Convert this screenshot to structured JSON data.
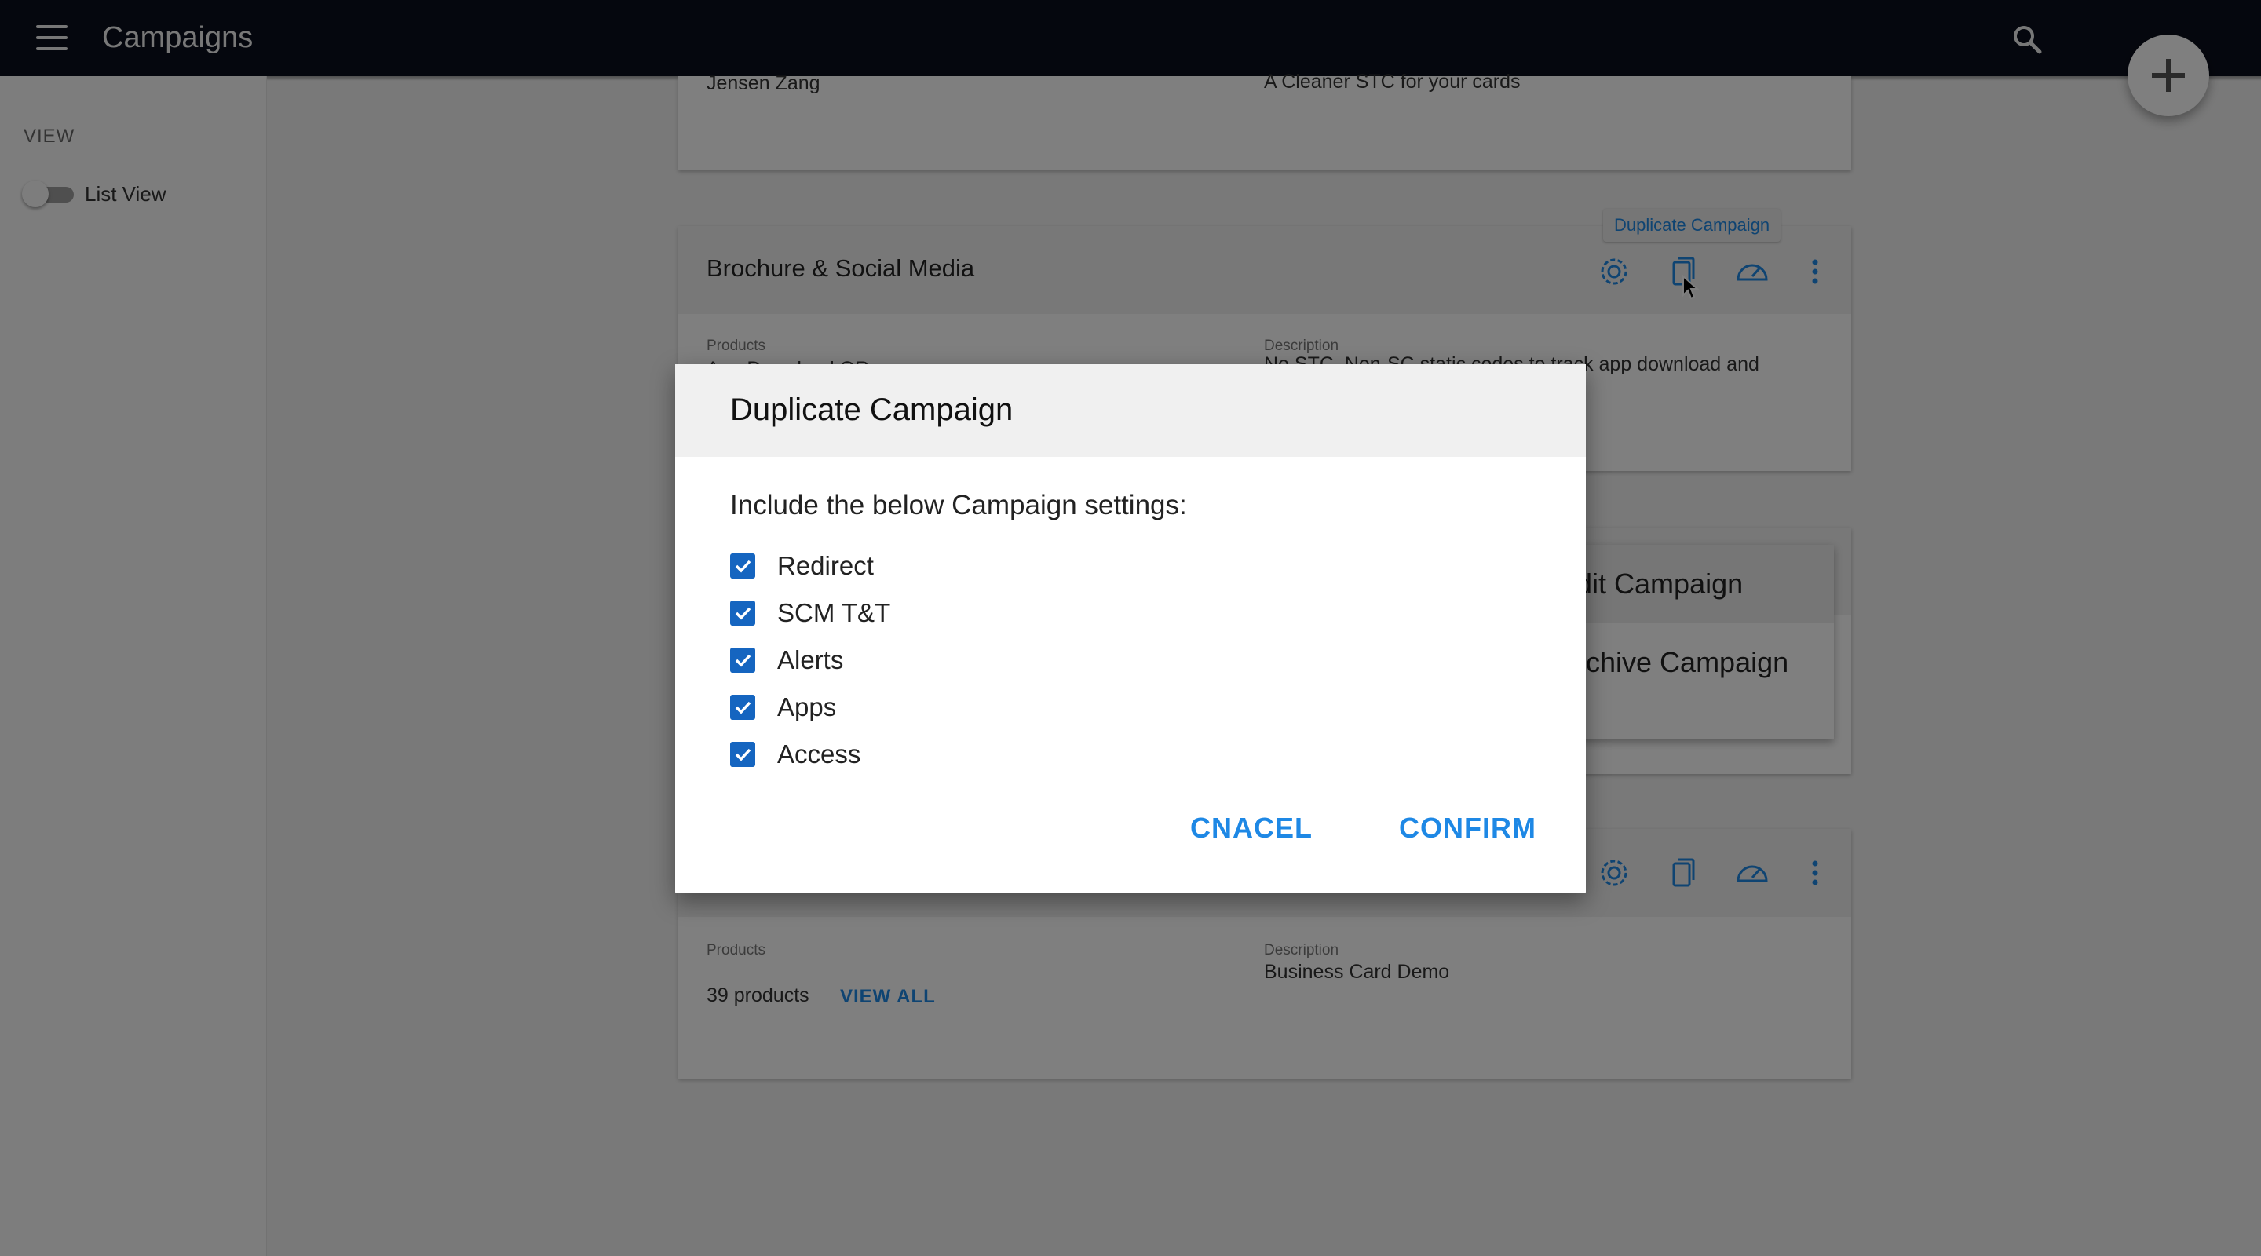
{
  "app_bar": {
    "title": "Campaigns"
  },
  "sidebar": {
    "section_label": "VIEW",
    "toggle_label": "List View",
    "toggle_on": false
  },
  "cards": [
    {
      "owner": "Jensen Zang",
      "description": "A Cleaner STC for your cards"
    },
    {
      "title": "Brochure & Social Media",
      "products_label": "Products",
      "products_value": "App Download QR",
      "description_label": "Description",
      "description": "No STC, Non-SC static codes to track app download and media."
    },
    {
      "products_label": "Products",
      "products_value": "39 products",
      "view_all": "VIEW ALL",
      "description_label": "Description",
      "description": "Business Card Demo"
    }
  ],
  "tooltip": "Duplicate Campaign",
  "context_menu": {
    "items": [
      "Edit Campaign",
      "Archive Campaign"
    ]
  },
  "dialog": {
    "title": "Duplicate Campaign",
    "description": "Include the below Campaign settings:",
    "options": [
      {
        "label": "Redirect",
        "checked": true
      },
      {
        "label": "SCM T&T",
        "checked": true
      },
      {
        "label": "Alerts",
        "checked": true
      },
      {
        "label": "Apps",
        "checked": true
      },
      {
        "label": "Access",
        "checked": true
      }
    ],
    "cancel_label": "CNACEL",
    "confirm_label": "CONFIRM"
  },
  "colors": {
    "accent": "#1e88e5",
    "checkbox": "#1565c0",
    "app_bar": "#0b0f1d"
  },
  "icons": [
    "menu-icon",
    "search-icon",
    "add-icon",
    "gear-icon",
    "copy-icon",
    "speedometer-icon",
    "more-vert-icon",
    "check-icon",
    "cursor-icon"
  ]
}
